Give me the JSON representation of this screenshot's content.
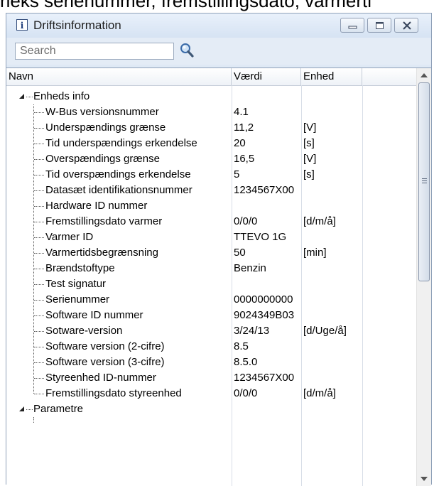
{
  "top_caption": "rieks serienummer, fremstillingsdato, varmerti",
  "window": {
    "title": "Driftsinformation",
    "icon": "info-icon",
    "buttons": [
      "minimize-icon",
      "maximize-icon",
      "close-icon"
    ]
  },
  "search": {
    "placeholder": "Search",
    "value": "",
    "icon": "search-icon"
  },
  "columns": {
    "name": "Navn",
    "value": "Værdi",
    "unit": "Enhed"
  },
  "tree": [
    {
      "label": "Enheds info",
      "expanded": true,
      "children": [
        {
          "name": "W-Bus versionsnummer",
          "value": "4.1",
          "unit": ""
        },
        {
          "name": "Underspændings grænse",
          "value": "11,2",
          "unit": "[V]"
        },
        {
          "name": "Tid underspændings erkendelse",
          "value": "20",
          "unit": "[s]"
        },
        {
          "name": "Overspændings grænse",
          "value": "16,5",
          "unit": "[V]"
        },
        {
          "name": "Tid overspændings erkendelse",
          "value": "5",
          "unit": "[s]"
        },
        {
          "name": "Datasæt identifikationsnummer",
          "value": "1234567X00",
          "unit": ""
        },
        {
          "name": "Hardware ID nummer",
          "value": "",
          "unit": ""
        },
        {
          "name": "Fremstillingsdato varmer",
          "value": "0/0/0",
          "unit": "[d/m/å]"
        },
        {
          "name": "Varmer ID",
          "value": "TTEVO 1G",
          "unit": ""
        },
        {
          "name": "Varmertidsbegrænsning",
          "value": "50",
          "unit": "[min]"
        },
        {
          "name": "Brændstoftype",
          "value": "Benzin",
          "unit": ""
        },
        {
          "name": "Test signatur",
          "value": "",
          "unit": ""
        },
        {
          "name": "Serienummer",
          "value": "0000000000",
          "unit": ""
        },
        {
          "name": "Software ID nummer",
          "value": "9024349B03",
          "unit": ""
        },
        {
          "name": "Sotware-version",
          "value": "3/24/13",
          "unit": "[d/Uge/å]"
        },
        {
          "name": "Software version (2-cifre)",
          "value": "8.5",
          "unit": ""
        },
        {
          "name": "Software version (3-cifre)",
          "value": "8.5.0",
          "unit": ""
        },
        {
          "name": "Styreenhed ID-nummer",
          "value": "1234567X00",
          "unit": ""
        },
        {
          "name": "Fremstillingsdato styreenhed",
          "value": "0/0/0",
          "unit": "[d/m/å]"
        }
      ]
    },
    {
      "label": "Parametre",
      "expanded": true,
      "children": []
    }
  ],
  "scrollbar": {
    "up_icon": "scroll-up-arrow-icon",
    "down_icon": "scroll-down-arrow-icon"
  }
}
